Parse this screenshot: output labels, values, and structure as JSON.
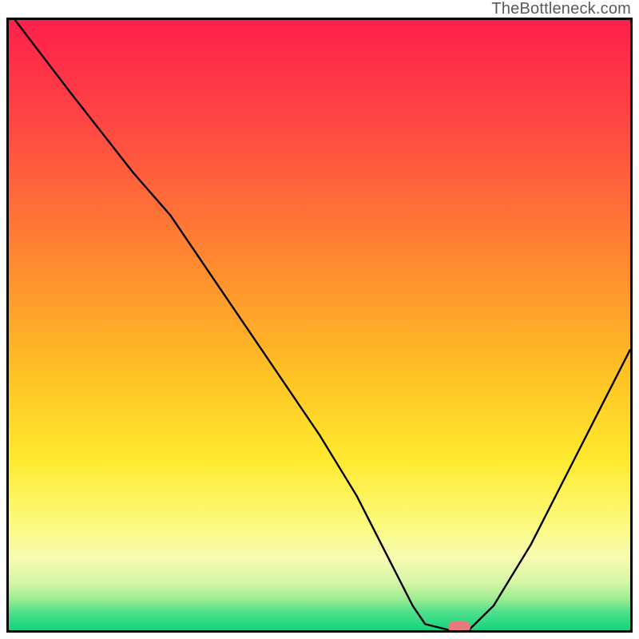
{
  "watermark": "TheBottleneck.com",
  "chart_data": {
    "type": "line",
    "title": "",
    "xlabel": "",
    "ylabel": "",
    "xlim": [
      0,
      100
    ],
    "ylim": [
      0,
      100
    ],
    "series": [
      {
        "name": "bottleneck-curve",
        "x": [
          1,
          10,
          20,
          26,
          34,
          42,
          50,
          56,
          60,
          63,
          65,
          67,
          71,
          74,
          78,
          84,
          90,
          96,
          100
        ],
        "values": [
          100,
          88,
          75,
          68,
          56,
          44,
          32,
          22,
          14,
          8,
          4,
          1,
          0,
          0,
          4,
          14,
          26,
          38,
          46
        ]
      }
    ],
    "marker": {
      "x": 72.5,
      "y": 0.5,
      "color": "#e97a7a"
    },
    "gradient_stops": [
      {
        "pos": 0,
        "color": "#ff1f4b"
      },
      {
        "pos": 18,
        "color": "#ff4a43"
      },
      {
        "pos": 40,
        "color": "#ff8a2f"
      },
      {
        "pos": 58,
        "color": "#ffc225"
      },
      {
        "pos": 72,
        "color": "#ffe92e"
      },
      {
        "pos": 82,
        "color": "#fdf979"
      },
      {
        "pos": 88,
        "color": "#f6fbb0"
      },
      {
        "pos": 92,
        "color": "#d8f6a6"
      },
      {
        "pos": 95,
        "color": "#9aec91"
      },
      {
        "pos": 97,
        "color": "#4fdf8c"
      },
      {
        "pos": 100,
        "color": "#16d47d"
      }
    ]
  }
}
